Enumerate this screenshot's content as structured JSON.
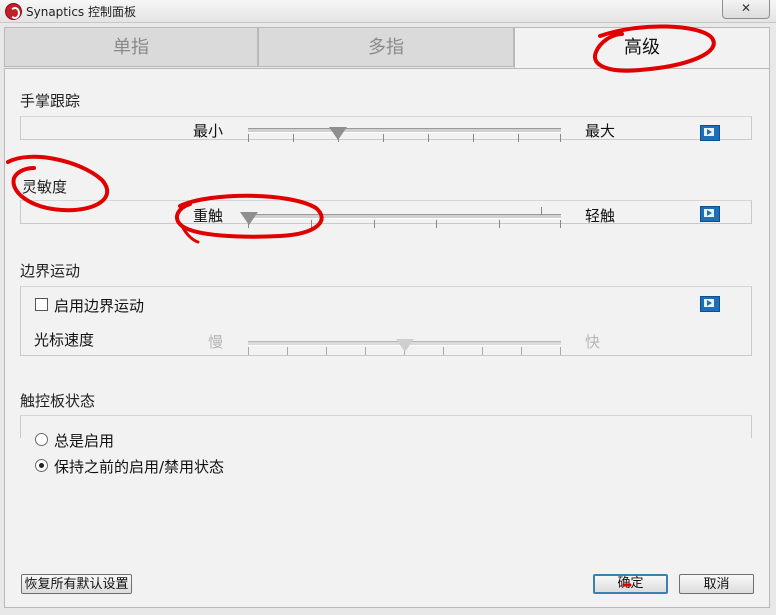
{
  "window": {
    "title": "Synaptics 控制面板",
    "close_label": "✕"
  },
  "tabs": [
    {
      "label": "单指",
      "active": false
    },
    {
      "label": "多指",
      "active": false
    },
    {
      "label": "高级",
      "active": true
    }
  ],
  "palm_tracking": {
    "label": "手掌跟踪",
    "min_label": "最小",
    "max_label": "最大",
    "value_fraction": 0.29
  },
  "sensitivity": {
    "label": "灵敏度",
    "min_label": "重触",
    "max_label": "轻触",
    "value_fraction": 0.0
  },
  "edge_motion": {
    "label": "边界运动",
    "enable_label": "启用边界运动",
    "enabled": false,
    "cursor_speed_label": "光标速度",
    "slow_label": "慢",
    "fast_label": "快",
    "value_fraction": 0.5
  },
  "touchpad_state": {
    "label": "触控板状态",
    "options": [
      "总是启用",
      "保持之前的启用/禁用状态"
    ],
    "selected_index": 1
  },
  "buttons": {
    "restore_defaults": "恢复所有默认设置",
    "ok": "确定",
    "cancel": "取消"
  },
  "colors": {
    "annotation_red": "#e00000",
    "accent_blue": "#1c6fb8"
  }
}
